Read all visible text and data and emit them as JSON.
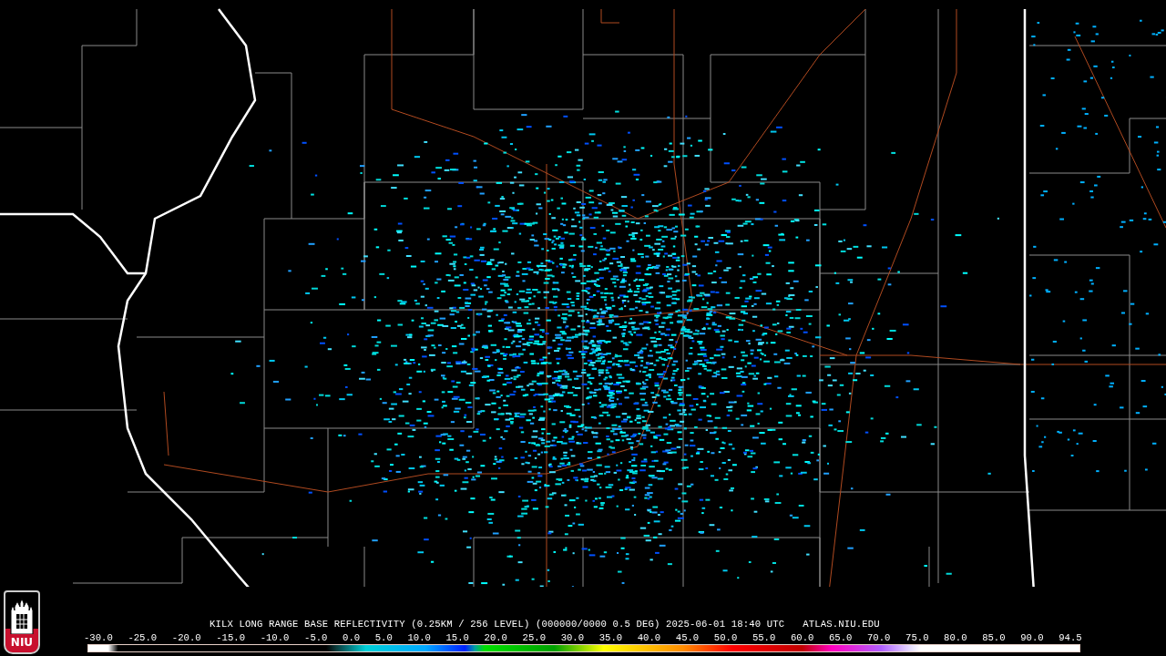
{
  "logo": {
    "text": "NIU"
  },
  "caption": {
    "product": "KILX LONG RANGE BASE REFLECTIVITY (0.25KM / 256 LEVEL) (000000/0000 0.5 DEG) 2025-06-01 18:40 UTC",
    "source": "ATLAS.NIU.EDU"
  },
  "legend": {
    "ticks": [
      "-30.0",
      "-25.0",
      "-20.0",
      "-15.0",
      "-10.0",
      "-5.0",
      "0.0",
      "5.0",
      "10.0",
      "15.0",
      "20.0",
      "25.0",
      "30.0",
      "35.0",
      "40.0",
      "45.0",
      "50.0",
      "55.0",
      "60.0",
      "65.0",
      "70.0",
      "75.0",
      "80.0",
      "85.0",
      "90.0",
      "94.5"
    ]
  }
}
